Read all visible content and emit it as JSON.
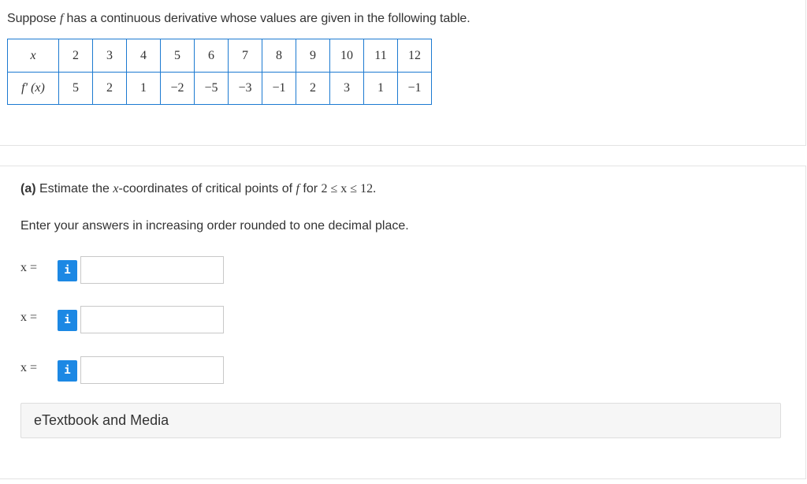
{
  "intro": {
    "pre": "Suppose ",
    "f": "f",
    "post": " has a continuous derivative whose values are given in the following table."
  },
  "table": {
    "row1_header": "x",
    "row2_header": "f′ (x)",
    "x_values": [
      "2",
      "3",
      "4",
      "5",
      "6",
      "7",
      "8",
      "9",
      "10",
      "11",
      "12"
    ],
    "fprime_values": [
      "5",
      "2",
      "1",
      "−2",
      "−5",
      "−3",
      "−1",
      "2",
      "3",
      "1",
      "−1"
    ]
  },
  "part_a": {
    "label": "(a)",
    "text1": " Estimate the ",
    "x": "x",
    "text2": "-coordinates of critical points of ",
    "f": "f",
    "text3": " for ",
    "range": "2 ≤ x ≤ 12.",
    "instruction": "Enter your answers in increasing order rounded to one decimal place."
  },
  "answers": [
    {
      "label": "x =",
      "info": "i",
      "value": ""
    },
    {
      "label": "x =",
      "info": "i",
      "value": ""
    },
    {
      "label": "x =",
      "info": "i",
      "value": ""
    }
  ],
  "etextbook": {
    "label": "eTextbook and Media"
  }
}
